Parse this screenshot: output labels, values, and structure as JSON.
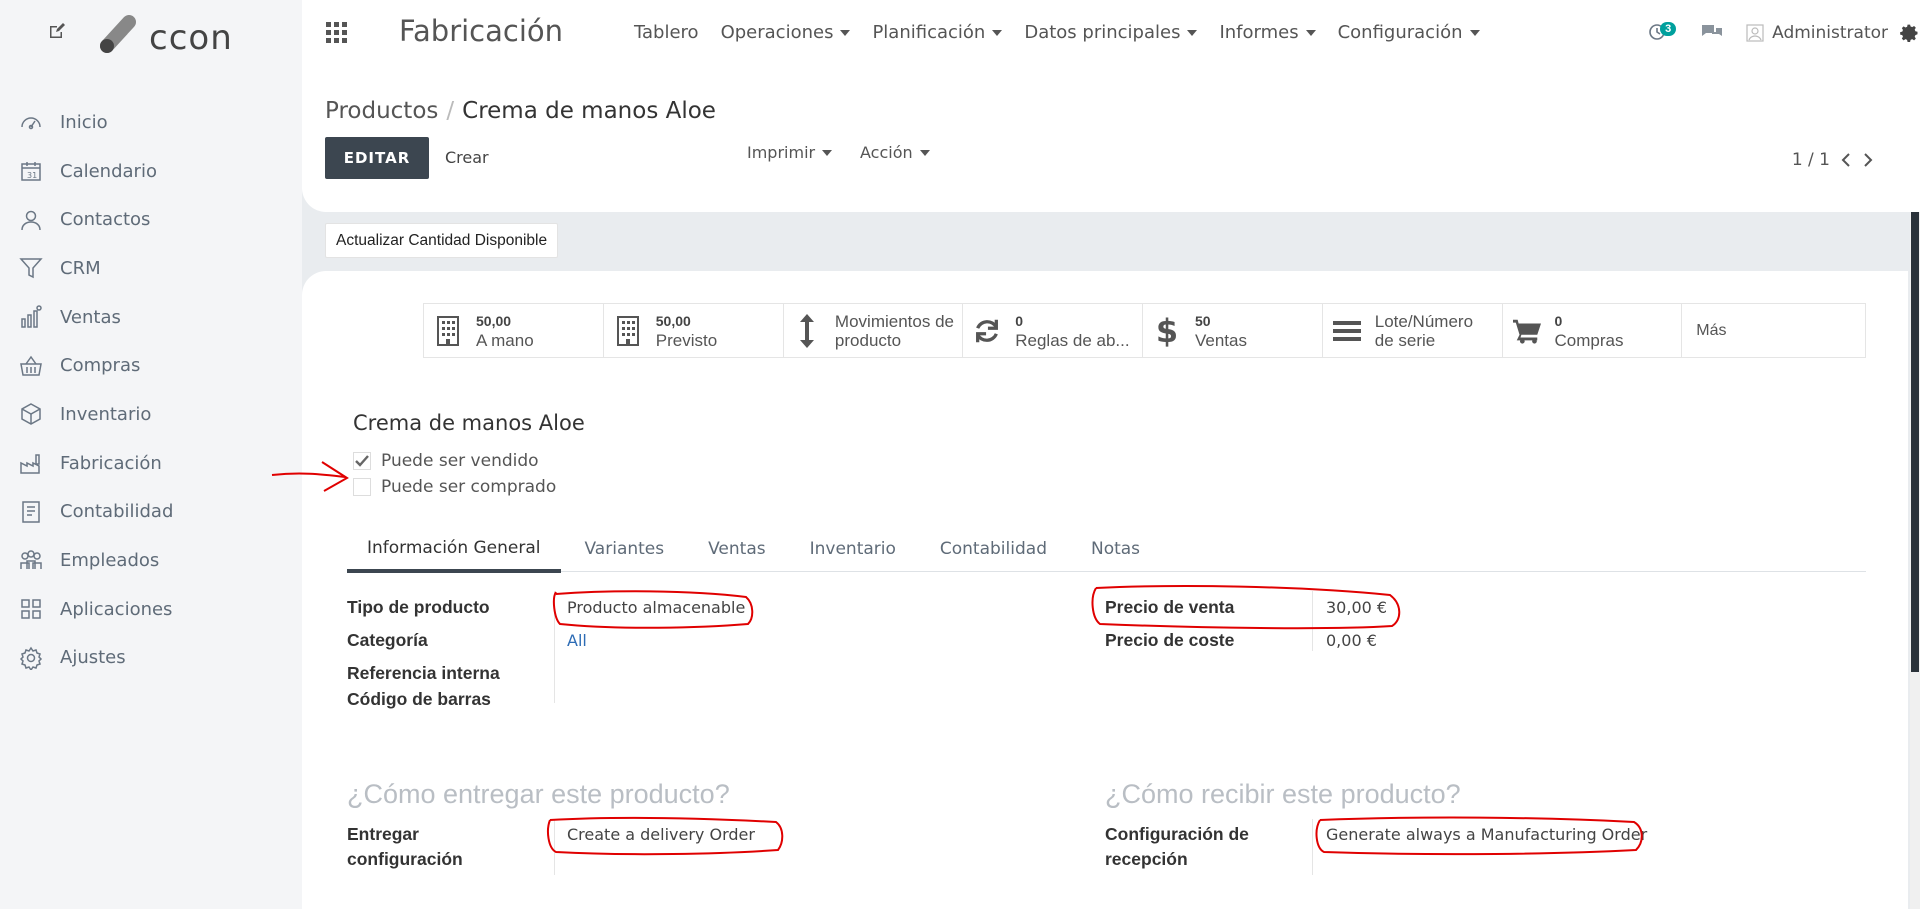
{
  "brand": {
    "logo_text": "ccon",
    "edit_icon": "edit-icon"
  },
  "sidebar": {
    "items": [
      {
        "label": "Inicio",
        "icon": "dashboard-icon"
      },
      {
        "label": "Calendario",
        "icon": "calendar-icon"
      },
      {
        "label": "Contactos",
        "icon": "user-icon"
      },
      {
        "label": "CRM",
        "icon": "filter-icon"
      },
      {
        "label": "Ventas",
        "icon": "chart-icon"
      },
      {
        "label": "Compras",
        "icon": "basket-icon"
      },
      {
        "label": "Inventario",
        "icon": "box-icon"
      },
      {
        "label": "Fabricación",
        "icon": "factory-icon"
      },
      {
        "label": "Contabilidad",
        "icon": "ledger-icon"
      },
      {
        "label": "Empleados",
        "icon": "people-icon"
      },
      {
        "label": "Aplicaciones",
        "icon": "grid-icon"
      },
      {
        "label": "Ajustes",
        "icon": "gear-icon"
      }
    ]
  },
  "topbar": {
    "app_title": "Fabricación",
    "nav": [
      {
        "label": "Tablero",
        "dropdown": false
      },
      {
        "label": "Operaciones",
        "dropdown": true
      },
      {
        "label": "Planificación",
        "dropdown": true
      },
      {
        "label": "Datos principales",
        "dropdown": true
      },
      {
        "label": "Informes",
        "dropdown": true
      },
      {
        "label": "Configuración",
        "dropdown": true
      }
    ],
    "activity_count": "3",
    "user": "Administrator"
  },
  "control": {
    "breadcrumb_parent": "Productos",
    "breadcrumb_current": "Crema de manos Aloe",
    "edit_label": "EDITAR",
    "create_label": "Crear",
    "print_label": "Imprimir",
    "action_label": "Acción",
    "pager": "1 / 1"
  },
  "update_qty_label": "Actualizar Cantidad Disponible",
  "stats": [
    {
      "value": "50,00",
      "label": "A mano",
      "icon": "building-icon"
    },
    {
      "value": "50,00",
      "label": "Previsto",
      "icon": "building-icon"
    },
    {
      "value": "",
      "label": "Movimientos de producto",
      "icon": "arrows-vertical-icon"
    },
    {
      "value": "0",
      "label": "Reglas de ab...",
      "icon": "refresh-icon"
    },
    {
      "value": "50",
      "label": "Ventas",
      "icon": "dollar-icon"
    },
    {
      "value": "",
      "label": "Lote/Número de serie",
      "icon": "list-icon"
    },
    {
      "value": "0",
      "label": "Compras",
      "icon": "cart-icon"
    },
    {
      "value": "",
      "label": "Más",
      "icon": ""
    }
  ],
  "product": {
    "name": "Crema de manos Aloe",
    "can_be_sold": {
      "label": "Puede ser vendido",
      "checked": true
    },
    "can_be_purchased": {
      "label": "Puede ser comprado",
      "checked": false
    }
  },
  "tabs": [
    "Información General",
    "Variantes",
    "Ventas",
    "Inventario",
    "Contabilidad",
    "Notas"
  ],
  "general": {
    "product_type_label": "Tipo de producto",
    "product_type_value": "Producto almacenable",
    "category_label": "Categoría",
    "category_value": "All",
    "internal_ref_label": "Referencia interna",
    "barcode_label": "Código de barras",
    "sale_price_label": "Precio de venta",
    "sale_price_value": "30,00 €",
    "cost_label": "Precio de coste",
    "cost_value": "0,00 €"
  },
  "delivery": {
    "title": "¿Cómo entregar este producto?",
    "label_line1": "Entregar",
    "label_line2": "configuración",
    "value": "Create a delivery Order"
  },
  "reception": {
    "title": "¿Cómo recibir este producto?",
    "label_line1": "Configuración de",
    "label_line2": "recepción",
    "value": "Generate always a Manufacturing Order"
  },
  "colors": {
    "primary": "#3c4650",
    "link": "#2d6cb5",
    "badge": "#00a09d",
    "annotation": "#e00000"
  }
}
